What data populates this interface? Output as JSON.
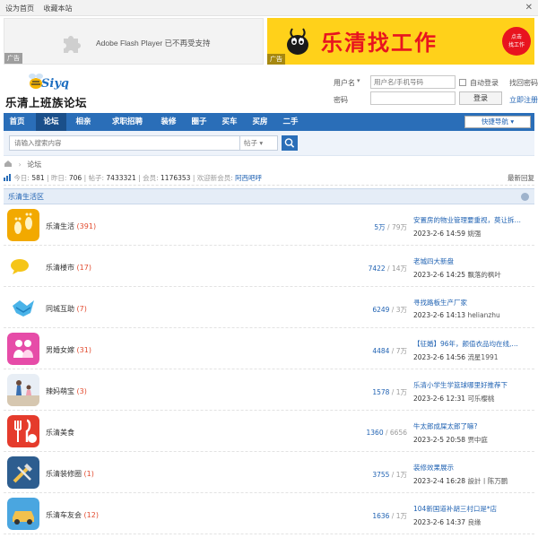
{
  "topbar": {
    "set_home": "设为首页",
    "bookmark": "收藏本站",
    "close": "✕"
  },
  "ads": {
    "left_text": "Adobe Flash Player 已不再受支持",
    "left_tag": "广告",
    "right_title": "乐清找工作",
    "right_badge_line1": "点击",
    "right_badge_line2": "找工作",
    "right_tag": "广告"
  },
  "logo": {
    "brand": "Siyq",
    "title": "乐清上班族论坛"
  },
  "login": {
    "username_label": "用户名",
    "username_placeholder": "用户名/手机号码",
    "auto_login": "自动登录",
    "forgot": "找回密码",
    "password_label": "密码",
    "login_button": "登录",
    "register": "立即注册"
  },
  "nav": {
    "items": [
      "首页",
      "论坛",
      "相亲",
      "求职招聘",
      "装修",
      "圈子",
      "买车",
      "买房",
      "二手"
    ],
    "quick": "快捷导航"
  },
  "search": {
    "placeholder": "请输入搜索内容",
    "type": "帖子"
  },
  "breadcrumb": {
    "current": "论坛"
  },
  "stats": {
    "today_label": "今日:",
    "today": "581",
    "yesterday_label": "昨日:",
    "yesterday": "706",
    "posts_label": "帖子:",
    "posts": "7433321",
    "members_label": "会员:",
    "members": "1176353",
    "welcome_label": "欢迎新会员:",
    "new_member": "阿西吧呼",
    "latest": "最新回复"
  },
  "section": {
    "title": "乐清生活区"
  },
  "forums": [
    {
      "name": "乐清生活",
      "today": "(391)",
      "threads": "5万",
      "posts": "79万",
      "last_title": "安置房的物业管理要重视，莫让拆…",
      "last_time": "2023-2-6 14:59",
      "last_user": "姚强",
      "icon": "footprint-icon"
    },
    {
      "name": "乐清楼市",
      "today": "(17)",
      "threads": "7422",
      "posts": "14万",
      "last_title": "老城四大新盘",
      "last_time": "2023-2-6 14:25",
      "last_user": "飘落的枫叶",
      "icon": "chat-bubble-icon"
    },
    {
      "name": "同城互助",
      "today": "(7)",
      "threads": "6249",
      "posts": "3万",
      "last_title": "寻找路板生产厂家",
      "last_time": "2023-2-6 14:13",
      "last_user": "helianzhu",
      "icon": "handshake-icon"
    },
    {
      "name": "男婚女嫁",
      "today": "(31)",
      "threads": "4484",
      "posts": "7万",
      "last_title": "【征婚】96年，颜值衣品均在线,…",
      "last_time": "2023-2-6 14:56",
      "last_user": "流星1991",
      "icon": "couple-icon"
    },
    {
      "name": "辣妈萌宝",
      "today": "(3)",
      "threads": "1578",
      "posts": "1万",
      "last_title": "乐清小学生学篮球哪里好推荐下",
      "last_time": "2023-2-6 12:31",
      "last_user": "可乐樱桃",
      "icon": "mother-icon"
    },
    {
      "name": "乐清美食",
      "today": "",
      "threads": "1360",
      "posts": "6656",
      "last_title": "牛太郎成屎太郎了嘛?",
      "last_time": "2023-2-5 20:58",
      "last_user": "贾中庭",
      "icon": "cutlery-icon"
    },
    {
      "name": "乐清装修圈",
      "today": "(1)",
      "threads": "3755",
      "posts": "1万",
      "last_title": "装修效果展示",
      "last_time": "2023-2-4 16:28",
      "last_user": "設計丨陈万鹏",
      "icon": "tools-icon"
    },
    {
      "name": "乐清车友会",
      "today": "(12)",
      "threads": "1636",
      "posts": "1万",
      "last_title": "104新国道补胡三村口是*店",
      "last_time": "2023-2-6 14:37",
      "last_user": "良缘",
      "icon": "car-icon"
    }
  ]
}
